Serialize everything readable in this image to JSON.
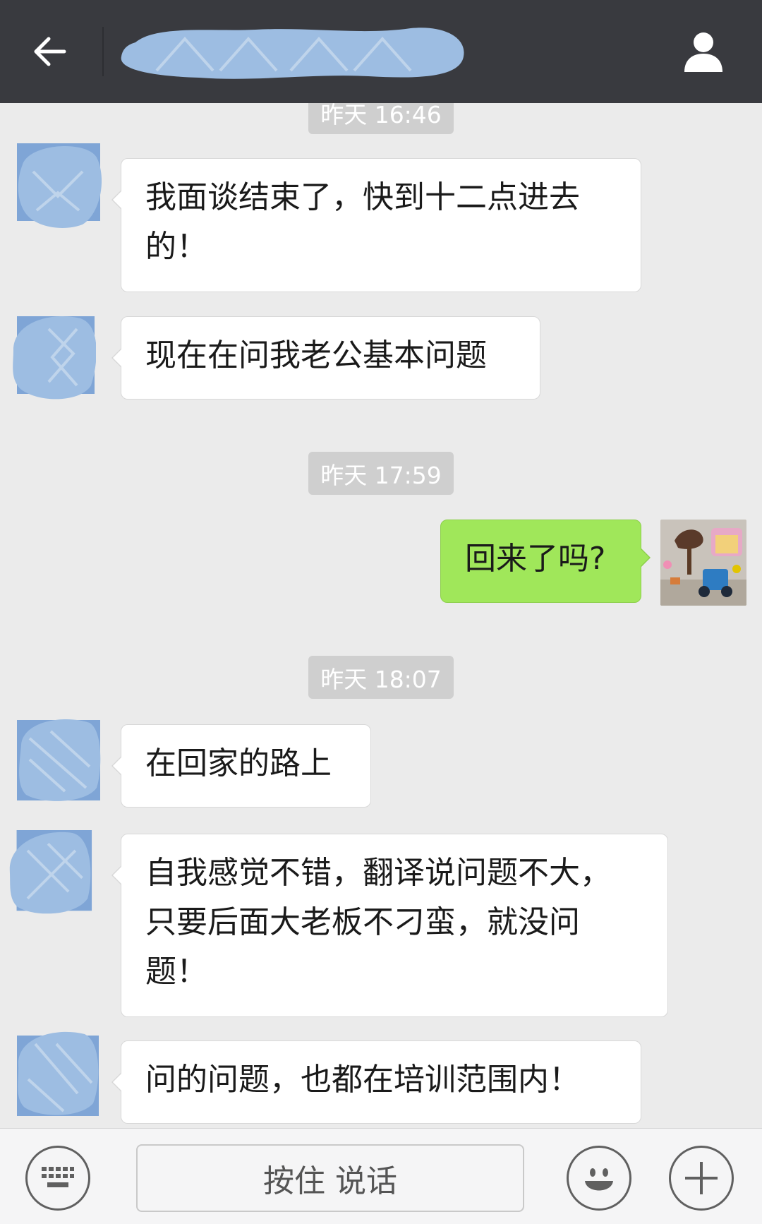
{
  "header": {
    "back_icon": "arrow-left-icon",
    "profile_icon": "person-icon",
    "title_redacted": true
  },
  "messages": [
    {
      "type": "timestamp",
      "text": "昨天 16:46"
    },
    {
      "type": "incoming",
      "text": "我面谈结束了，快到十二点进去\n的！"
    },
    {
      "type": "incoming",
      "text": "现在在问我老公基本问题"
    },
    {
      "type": "timestamp",
      "text": "昨天 17:59"
    },
    {
      "type": "outgoing",
      "text": "回来了吗?"
    },
    {
      "type": "timestamp",
      "text": "昨天 18:07"
    },
    {
      "type": "incoming",
      "text": "在回家的路上"
    },
    {
      "type": "incoming",
      "text": "自我感觉不错，翻译说问题不大，\n只要后面大老板不刁蛮，就没问\n题！"
    },
    {
      "type": "incoming",
      "text": "问的问题，也都在培训范围内！"
    }
  ],
  "bottombar": {
    "voice_label": "按住 说话",
    "keyboard_icon": "keyboard-icon",
    "emoji_icon": "smiley-icon",
    "plus_icon": "plus-icon"
  },
  "colors": {
    "header_bg": "#393a3f",
    "chat_bg": "#ebebeb",
    "outgoing_bubble": "#a0e75a",
    "incoming_bubble": "#ffffff",
    "redaction_blue": "#9dbde2"
  }
}
